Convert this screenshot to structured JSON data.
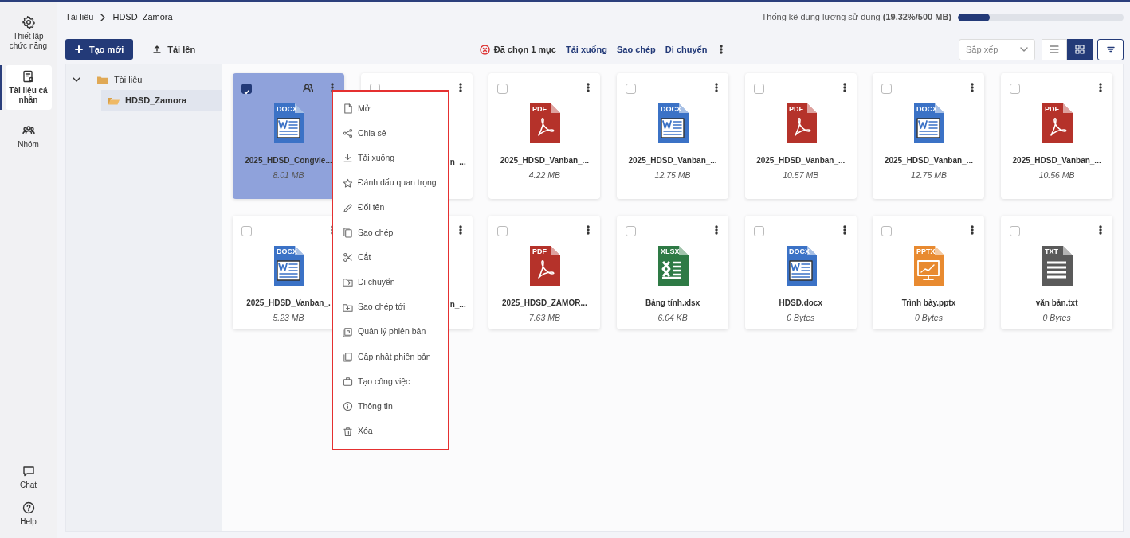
{
  "sidebar": {
    "items": [
      {
        "label": "Thiết lập chức năng",
        "selected": false
      },
      {
        "label": "Tài liệu cá nhân",
        "selected": true
      },
      {
        "label": "Nhóm",
        "selected": false
      }
    ],
    "bottom_items": [
      {
        "label": "Chat"
      },
      {
        "label": "Help"
      }
    ]
  },
  "breadcrumb": [
    "Tài liệu",
    "HDSD_Zamora"
  ],
  "storage": {
    "label": "Thống kê dung lượng sử dụng **(19.32%/500 MB)**",
    "level": 0.1932
  },
  "toolbar": {
    "create_button": "Tạo mới",
    "upload_button": "Tải lên"
  },
  "selection_bar": {
    "count": "Đã chọn 1 mục",
    "actions": [
      "Tải xuống",
      "Sao chép",
      "Di chuyển"
    ]
  },
  "sort": {
    "placeholder": "Sắp xếp"
  },
  "view_modes": [
    {
      "kind": "list",
      "selected": false
    },
    {
      "kind": "grid",
      "selected": true
    }
  ],
  "tree": [
    {
      "label": "Tài liệu",
      "expanded": true,
      "selected": false,
      "children": [
        {
          "label": "HDSD_Zamora",
          "selected": true
        }
      ]
    }
  ],
  "files": [
    {
      "kind": "docx",
      "type_label": "DOCX",
      "name": "2025_HDSD_Congvie...",
      "size": "8.01 MB",
      "selected": true,
      "shared": true
    },
    {
      "name": "n_...",
      "selected": false
    },
    {
      "kind": "pdf",
      "type_label": "PDF",
      "name": "2025_HDSD_Vanban_...",
      "size": "4.22 MB",
      "selected": false
    },
    {
      "kind": "docx",
      "type_label": "DOCX",
      "name": "2025_HDSD_Vanban_...",
      "size": "12.75 MB",
      "selected": false
    },
    {
      "kind": "pdf",
      "type_label": "PDF",
      "name": "2025_HDSD_Vanban_...",
      "size": "10.57 MB",
      "selected": false
    },
    {
      "kind": "docx",
      "type_label": "DOCX",
      "name": "2025_HDSD_Vanban_...",
      "size": "12.75 MB",
      "selected": false
    },
    {
      "kind": "pdf",
      "type_label": "PDF",
      "name": "2025_HDSD_Vanban_...",
      "size": "10.56 MB",
      "selected": false
    },
    {
      "kind": "docx",
      "type_label": "DOCX",
      "name": "2025_HDSD_Vanban_.",
      "size": "5.23 MB",
      "selected": false
    },
    {
      "name": "n_..."
    },
    {
      "kind": "pdf",
      "type_label": "PDF",
      "name": "2025_HDSD_ZAMOR...",
      "size": "7.63 MB",
      "selected": false
    },
    {
      "kind": "xlsx",
      "type_label": "XLSX",
      "name": "Bảng tính.xlsx",
      "size": "6.04 KB",
      "selected": false
    },
    {
      "kind": "docx",
      "type_label": "DOCX",
      "name": "HDSD.docx",
      "size": "0 Bytes",
      "selected": false
    },
    {
      "kind": "pptx",
      "type_label": "PPTX",
      "name": "Trình bày.pptx",
      "size": "0 Bytes",
      "selected": false
    },
    {
      "kind": "txt",
      "type_label": "TXT",
      "name": "văn bản.txt",
      "size": "0 Bytes",
      "selected": false
    }
  ],
  "context_menu": [
    "Mở",
    "Chia sẻ",
    "Tải xuống",
    "Đánh dấu quan trọng",
    "Đổi tên",
    "Sao chép",
    "Cắt",
    "Di chuyển",
    "Sao chép tới",
    "Quản lý phiên bản",
    "Cập nhật phiên bản",
    "Tạo công việc",
    "Thông tin",
    "Xóa"
  ]
}
